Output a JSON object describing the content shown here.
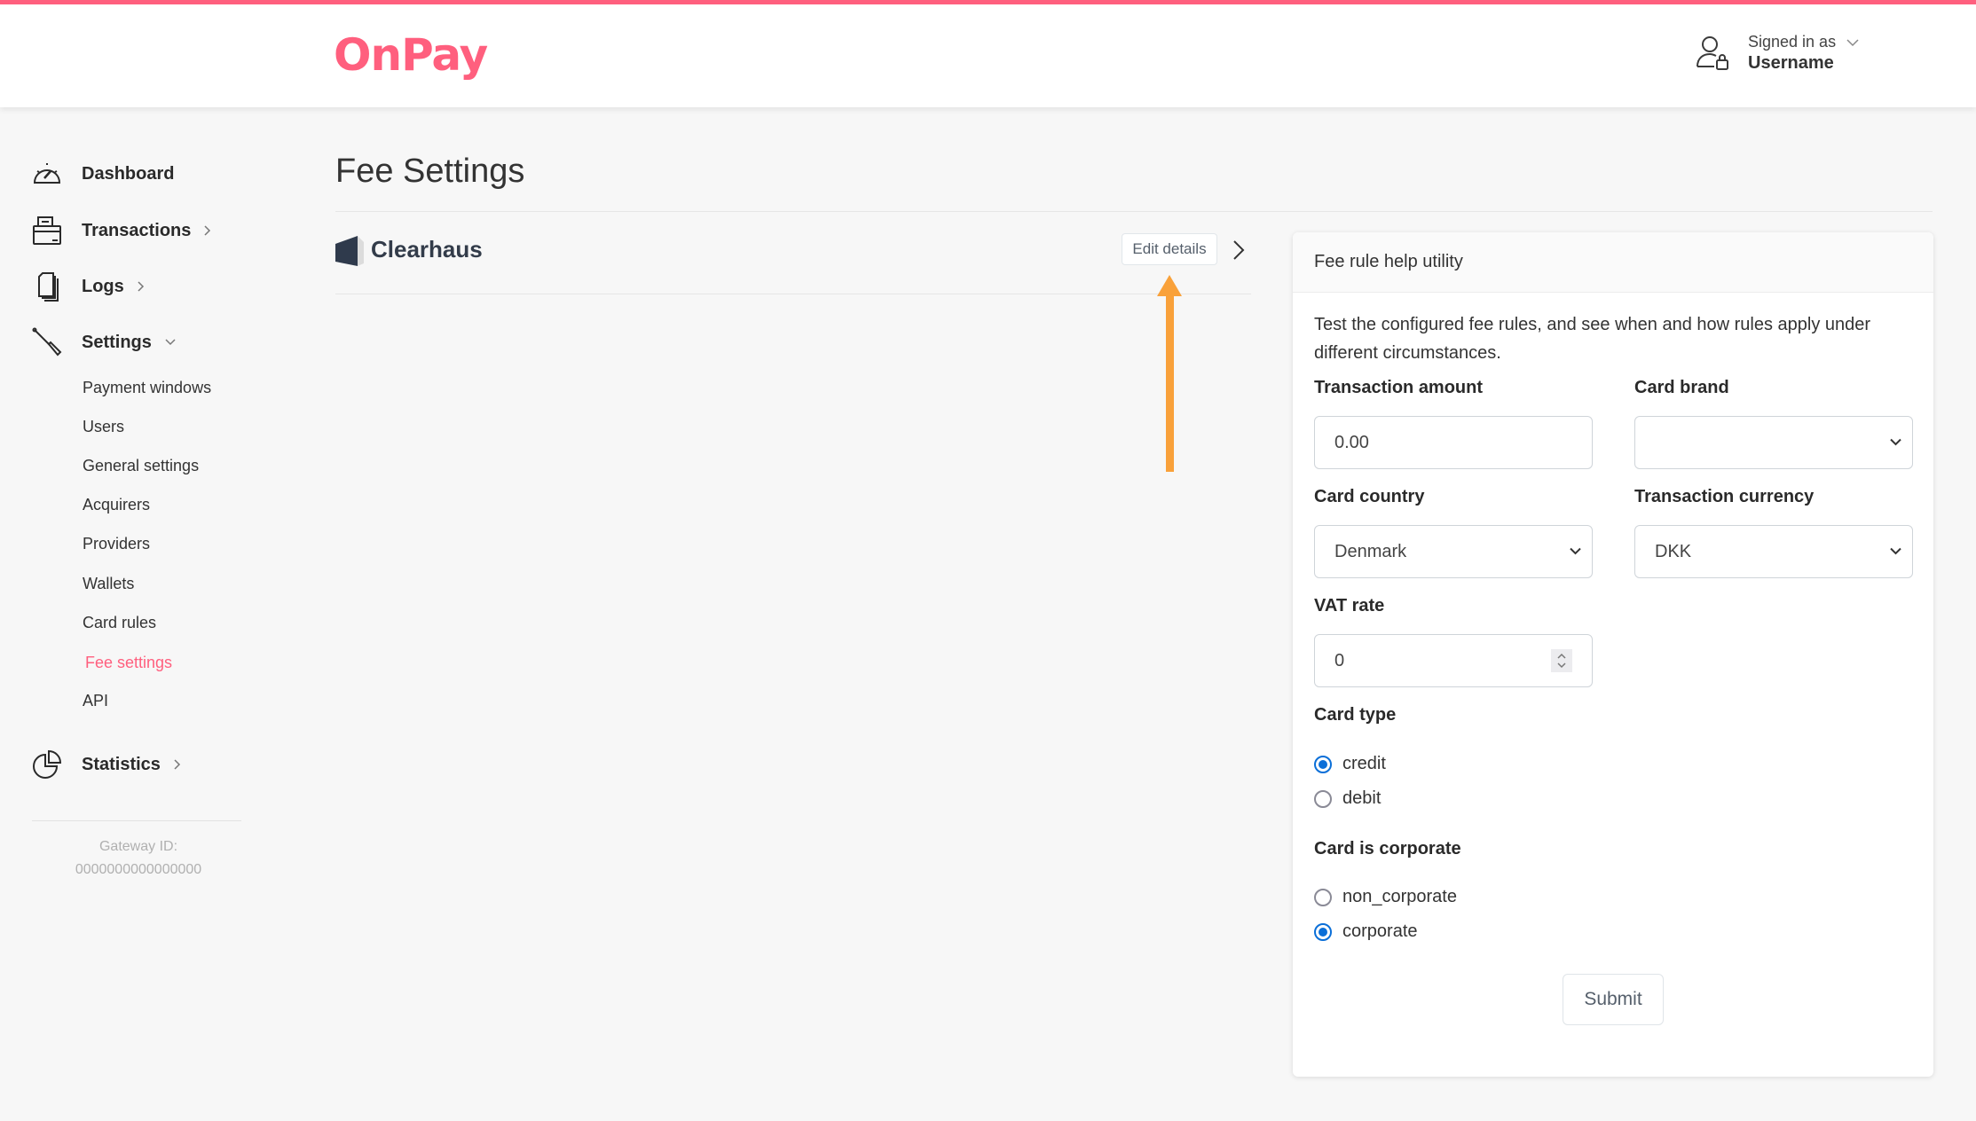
{
  "brand": {
    "logo_text": "OnPay",
    "accent_color": "#ff5f7e"
  },
  "header": {
    "signed_in_label": "Signed in as",
    "username": "Username",
    "user_icon": "user-lock-icon",
    "dropdown_icon": "chevron-down-icon"
  },
  "sidebar": {
    "main_items": [
      {
        "label": "Dashboard",
        "icon": "speedometer-icon",
        "expandable": false
      },
      {
        "label": "Transactions",
        "icon": "cash-register-icon",
        "expandable": true,
        "state": "collapsed"
      },
      {
        "label": "Logs",
        "icon": "documents-icon",
        "expandable": true,
        "state": "collapsed"
      },
      {
        "label": "Settings",
        "icon": "screwdriver-icon",
        "expandable": true,
        "state": "expanded"
      },
      {
        "label": "Statistics",
        "icon": "pie-chart-icon",
        "expandable": true,
        "state": "collapsed"
      }
    ],
    "settings_items": [
      {
        "label": "Payment windows",
        "active": false
      },
      {
        "label": "Users",
        "active": false
      },
      {
        "label": "General settings",
        "active": false
      },
      {
        "label": "Acquirers",
        "active": false
      },
      {
        "label": "Providers",
        "active": false
      },
      {
        "label": "Wallets",
        "active": false
      },
      {
        "label": "Card rules",
        "active": false
      },
      {
        "label": "Fee settings",
        "active": true
      },
      {
        "label": "API",
        "active": false
      }
    ],
    "gateway_label": "Gateway ID:",
    "gateway_id": "0000000000000000"
  },
  "main": {
    "title": "Fee Settings",
    "acquirer": {
      "name": "Clearhaus",
      "logo_icon": "clearhaus-logo-icon",
      "edit_label": "Edit details",
      "chevron_icon": "chevron-right-icon"
    },
    "annotation": {
      "type": "arrow-up",
      "color": "#f9a13a",
      "target": "Edit details"
    }
  },
  "fee_utility": {
    "title": "Fee rule help utility",
    "description": "Test the configured fee rules, and see when and how rules apply under different circumstances.",
    "fields": {
      "transaction_amount": {
        "label": "Transaction amount",
        "value": "0.00"
      },
      "card_brand": {
        "label": "Card brand",
        "value": ""
      },
      "card_country": {
        "label": "Card country",
        "value": "Denmark"
      },
      "transaction_currency": {
        "label": "Transaction currency",
        "value": "DKK"
      },
      "vat_rate": {
        "label": "VAT rate",
        "value": "0"
      }
    },
    "card_type": {
      "label": "Card type",
      "options": [
        {
          "label": "credit",
          "checked": true
        },
        {
          "label": "debit",
          "checked": false
        }
      ]
    },
    "card_corporate": {
      "label": "Card is corporate",
      "options": [
        {
          "label": "non_corporate",
          "checked": false
        },
        {
          "label": "corporate",
          "checked": true
        }
      ]
    },
    "submit_label": "Submit",
    "radio_color": "#0b6fd8"
  }
}
